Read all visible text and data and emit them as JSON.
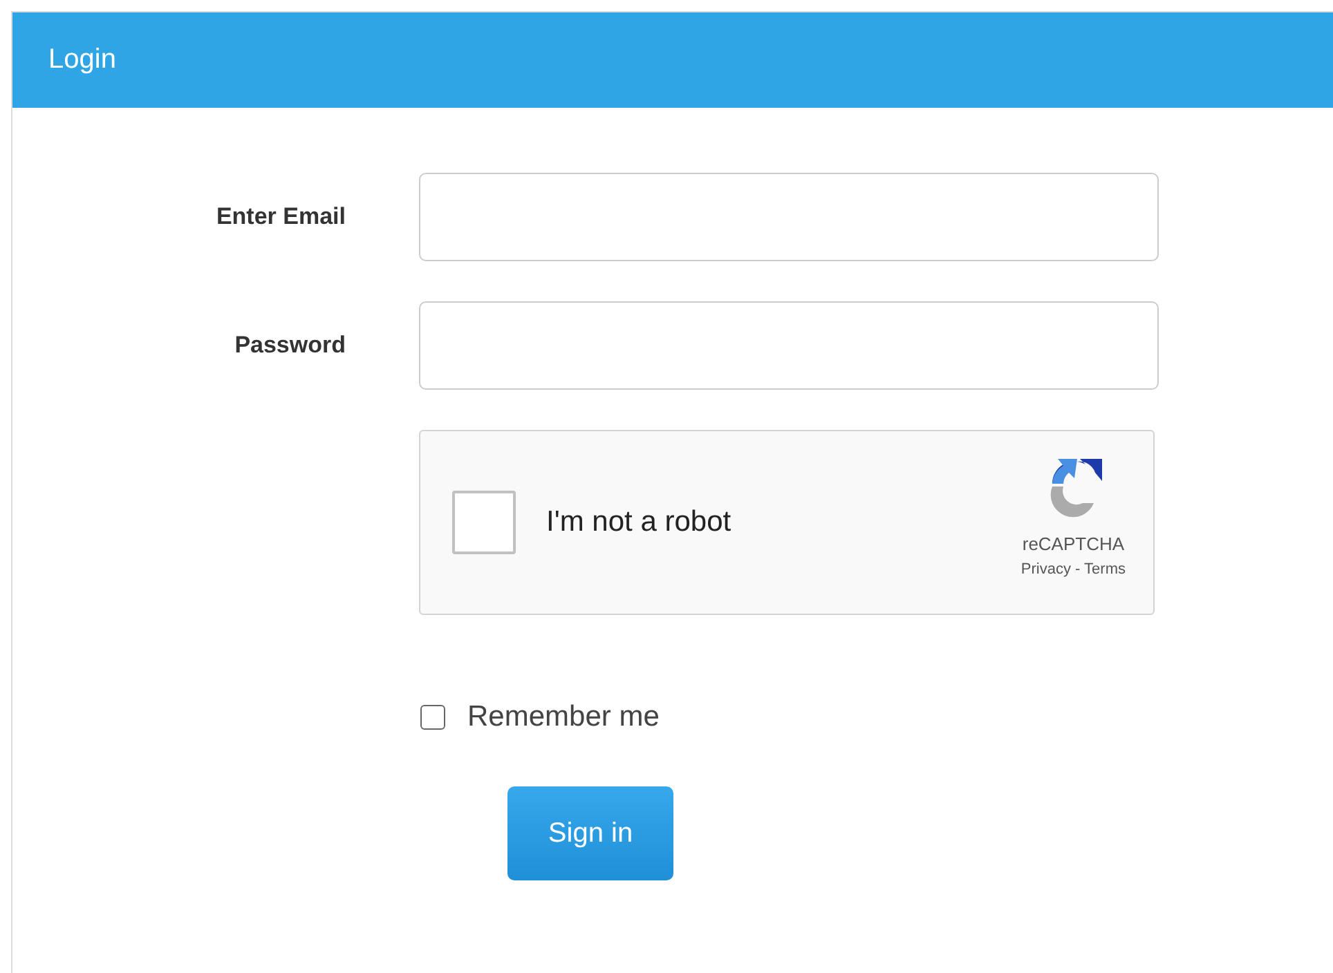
{
  "panel": {
    "title": "Login"
  },
  "fields": [
    {
      "label": "Enter Email"
    },
    {
      "label": "Password"
    }
  ],
  "captcha": {
    "checked": false,
    "label": "I'm not a robot",
    "brand": "reCAPTCHA",
    "privacy": "Privacy",
    "separator": " - ",
    "terms": "Terms"
  },
  "remember": {
    "label": "Remember me",
    "checked": false
  },
  "submit": {
    "label": "Sign in"
  }
}
